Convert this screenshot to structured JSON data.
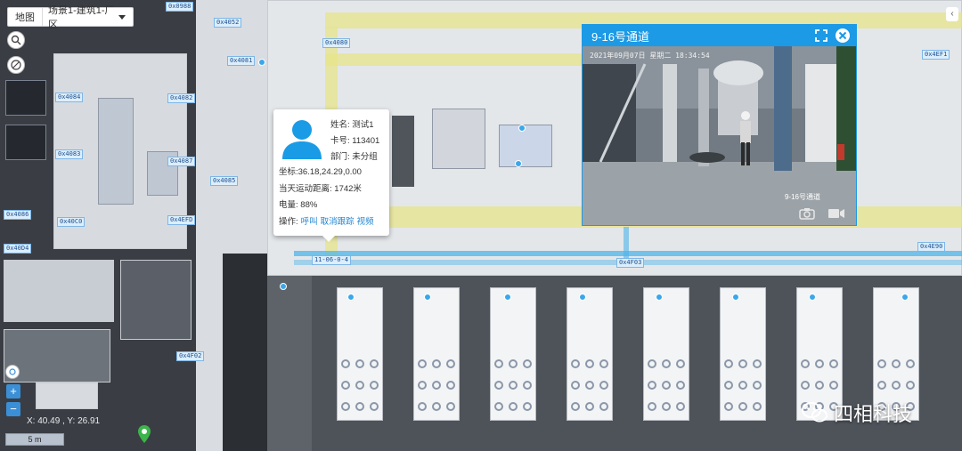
{
  "layer_select": {
    "label": "地图",
    "value": "场景1-建筑1-厂区"
  },
  "toolbar": {
    "search_icon": "search-icon",
    "draw_icon": "edit-icon"
  },
  "map": {
    "coords": "X: 40.49 , Y: 26.91",
    "scale": "5 m",
    "zoom_in": "+",
    "zoom_out": "−",
    "tags": [
      "0x0988",
      "0x4052",
      "0x4081",
      "0x4080",
      "0x4084",
      "0x4082",
      "0x4083",
      "0x4087",
      "0x4085",
      "0x4086",
      "0x40C0",
      "0x4EFD",
      "0x40D4",
      "0x4F02",
      "0x4EF1",
      "0x4F03",
      "0x4E90",
      "0x4E87",
      "0x4EFB",
      "0x4EF4",
      "0x4EF6",
      "0x4E4D",
      "0x4E4A"
    ],
    "track_label": "11-06-0-4"
  },
  "person": {
    "name_label": "姓名:",
    "name": "测试1",
    "card_label": "卡号:",
    "card": "113401",
    "dept_label": "部门:",
    "dept": "未分组",
    "coord_label": "坐标:",
    "coord": "36.18,24.29,0.00",
    "distance_label": "当天运动距离:",
    "distance": "1742米",
    "battery_label": "电量:",
    "battery": "88%",
    "ops_label": "操作:",
    "action_call": "呼叫",
    "action_untrack": "取消跟踪",
    "action_video": "视频"
  },
  "video": {
    "title": "9-16号通道",
    "osd": "2021年09月07日 星期二 18:34:54",
    "caption": "9-16号通道"
  },
  "brand": {
    "text": "四相科技"
  },
  "colors": {
    "accent": "#1c9ae6",
    "link": "#2185d0"
  }
}
